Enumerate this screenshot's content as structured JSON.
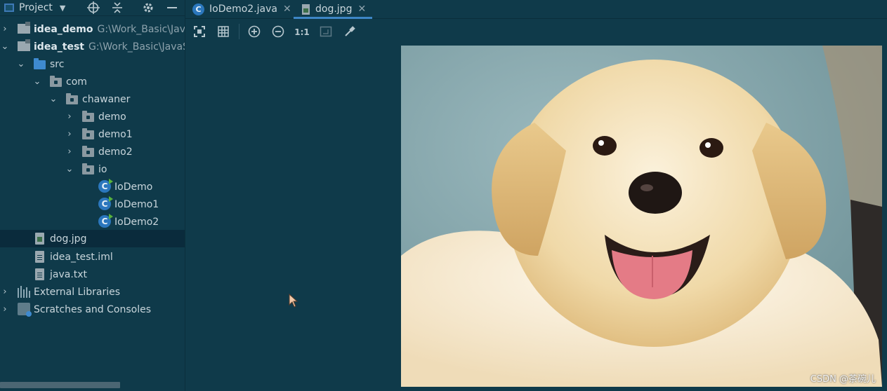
{
  "sidebar": {
    "title": "Project",
    "header_icons": [
      "crosshair-icon",
      "collapse-icon",
      "gear-icon",
      "minimize-icon"
    ],
    "tree": [
      {
        "label": "idea_demo",
        "hint": "G:\\Work_Basic\\JavaSE",
        "icon": "module-icon",
        "expanded": false
      },
      {
        "label": "idea_test",
        "hint": "G:\\Work_Basic\\JavaSE",
        "icon": "module-icon",
        "expanded": true
      },
      {
        "label": "src",
        "icon": "source-folder-icon",
        "expanded": true
      },
      {
        "label": "com",
        "icon": "package-icon",
        "expanded": true
      },
      {
        "label": "chawaner",
        "icon": "package-icon",
        "expanded": true
      },
      {
        "label": "demo",
        "icon": "package-icon",
        "expanded": false
      },
      {
        "label": "demo1",
        "icon": "package-icon",
        "expanded": false
      },
      {
        "label": "demo2",
        "icon": "package-icon",
        "expanded": false
      },
      {
        "label": "io",
        "icon": "package-icon",
        "expanded": true
      },
      {
        "label": "IoDemo",
        "icon": "java-class-icon"
      },
      {
        "label": "IoDemo1",
        "icon": "java-class-icon"
      },
      {
        "label": "IoDemo2",
        "icon": "java-class-icon"
      },
      {
        "label": "dog.jpg",
        "icon": "image-file-icon",
        "selected": true
      },
      {
        "label": "idea_test.iml",
        "icon": "file-icon"
      },
      {
        "label": "java.txt",
        "icon": "text-file-icon"
      },
      {
        "label": "External Libraries",
        "icon": "libraries-icon",
        "expanded": false
      },
      {
        "label": "Scratches and Consoles",
        "icon": "scratches-icon",
        "expanded": false
      }
    ]
  },
  "tabs": [
    {
      "label": "IoDemo2.java",
      "icon": "java-class-icon",
      "active": false
    },
    {
      "label": "dog.jpg",
      "icon": "image-file-icon",
      "active": true
    }
  ],
  "image_toolbar": {
    "actual_size_label": "1:1",
    "icons": [
      "fit-icon",
      "grid-icon",
      "zoom-in-icon",
      "zoom-out-icon",
      "actual-size-icon",
      "chessboard-icon",
      "color-picker-icon"
    ]
  },
  "image": {
    "subject": "dog-photo"
  },
  "watermark": "CSDN @茶碗儿",
  "colors": {
    "background": "#0f3a4a",
    "selection": "#0a2b3c",
    "accent": "#3d86c6"
  }
}
